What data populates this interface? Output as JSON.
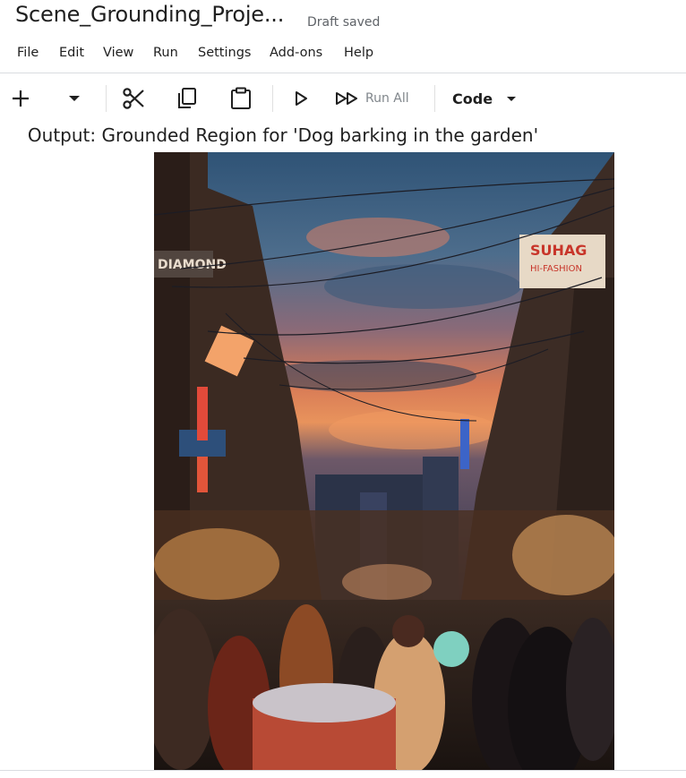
{
  "notebook": {
    "title": "Scene_Grounding_Proje...",
    "status": "Draft saved"
  },
  "menu": [
    "File",
    "Edit",
    "View",
    "Run",
    "Settings",
    "Add-ons",
    "Help"
  ],
  "toolbar": {
    "add_icon": "plus-icon",
    "dropdown_icon": "caret-down-icon",
    "cut_icon": "scissors-icon",
    "copy_icon": "copy-icon",
    "paste_icon": "clipboard-icon",
    "run_icon": "play-icon",
    "run_all_icon": "fast-forward-icon",
    "run_all_label": "Run All",
    "cell_type": "Code"
  },
  "output": {
    "title": "Output: Grounded Region for 'Dog barking in the garden'",
    "image_signs": {
      "suhag": "SUHAG",
      "hi_fashion": "HI-FASHION",
      "diamond": "DIAMOND"
    }
  },
  "colors": {
    "text": "#1f1f1f",
    "muted": "#5f6368",
    "divider": "#dadce0"
  }
}
